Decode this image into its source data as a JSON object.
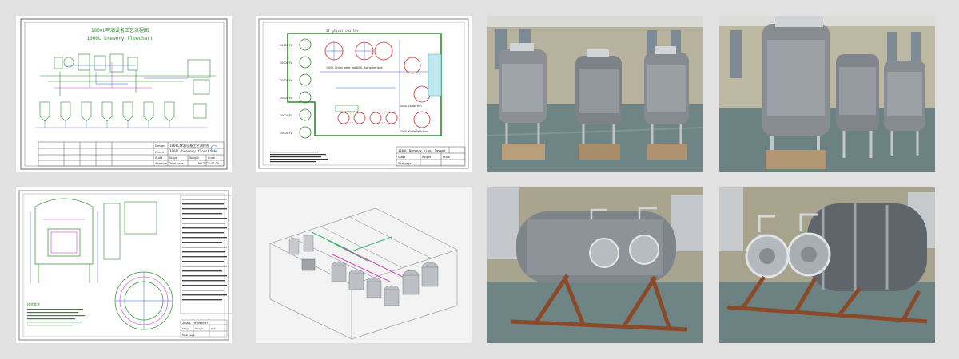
{
  "gallery": {
    "background": "#e1e1e1",
    "tiles": [
      {
        "kind": "drawing",
        "title_cn": "1000L啤酒设备工艺流程图",
        "title_en": "1000L brewery flowchart",
        "block_title": "1000L啤酒设备工艺流程图",
        "block_subtitle": "1000L brewery flowchart",
        "block_labels": [
          "Design",
          "Check",
          "Audit",
          "Approve"
        ],
        "block_fields": [
          "Stage",
          "Weight",
          "Scale"
        ],
        "block_page": "Total page",
        "block_no": "NO.2022-07-08"
      },
      {
        "kind": "drawing",
        "top_label": "5T glycol chiller",
        "tank_labels": [
          "1000L Glycol water tank",
          "1000L Hot water tank",
          "1000L Lauter tun",
          "1000L Kettle/Whirlpool"
        ],
        "fv_labels": [
          "2000L FV",
          "2000L FV",
          "2000L FV",
          "2000L FV",
          "2000L FV",
          "2000L FV"
        ],
        "block_title": "1000L Brewery plant layout",
        "block_fields": [
          "Stage",
          "Weight",
          "Scale"
        ],
        "block_page": "Total page"
      },
      {
        "kind": "photo",
        "subject": "stainless fermentation tanks wrapped in plastic on pallets"
      },
      {
        "kind": "photo",
        "subject": "wrapped conical tanks in workshop"
      },
      {
        "kind": "drawing",
        "notes_title": "技术要求",
        "block_title": "2000L Fermenter",
        "block_fields": [
          "Stage",
          "Weight",
          "Scale"
        ],
        "block_page": "Total page"
      },
      {
        "kind": "render",
        "subject": "3D brewery layout"
      },
      {
        "kind": "photo",
        "subject": "horizontal tanks on rust frames"
      },
      {
        "kind": "photo",
        "subject": "horizontal tank front manways"
      }
    ]
  },
  "colors": {
    "cad_green": "#2e8b2e",
    "cad_blue": "#2c5fd6",
    "cad_red": "#d42a2a",
    "cad_magenta": "#d13ad1",
    "cad_cyan": "#2bb6c9",
    "steel": "#b9bec3",
    "rust": "#8a4a2a",
    "wall": "#a9a48e",
    "floor": "#6f8484"
  }
}
